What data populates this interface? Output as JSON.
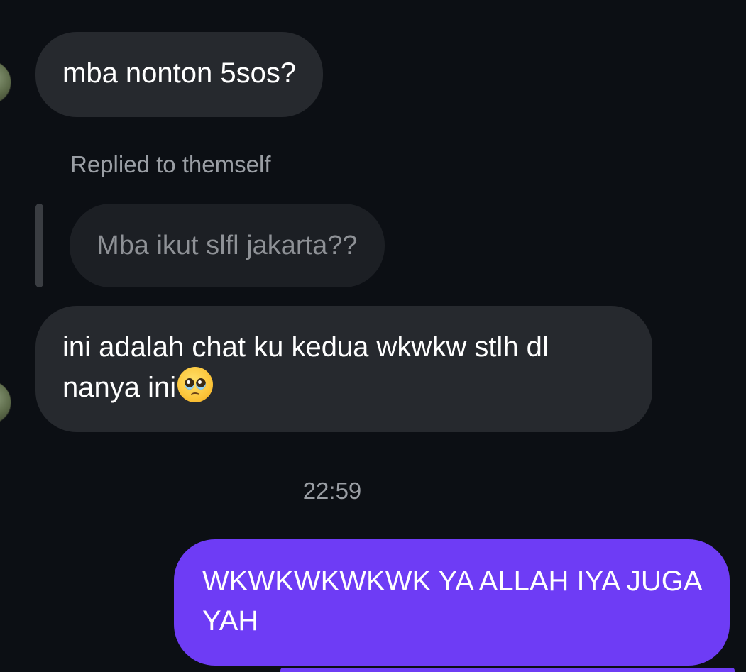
{
  "messages": {
    "incoming_1": "mba nonton 5sos?",
    "reply_label": "Replied to themself",
    "reply_quote": "Mba ikut slfl jakarta??",
    "incoming_2": "ini adalah chat ku kedua wkwkw stlh dl nanya ini",
    "incoming_2_emoji": "pleading-face-icon",
    "timestamp": "22:59",
    "outgoing_1": "WKWKWKWKWK YA ALLAH IYA JUGA YAH"
  },
  "colors": {
    "background": "#0c0f14",
    "incoming_bubble": "#26292e",
    "reply_bubble": "#1c1f24",
    "outgoing_bubble": "#6e3cf5",
    "meta_text": "#9a9ea4"
  }
}
